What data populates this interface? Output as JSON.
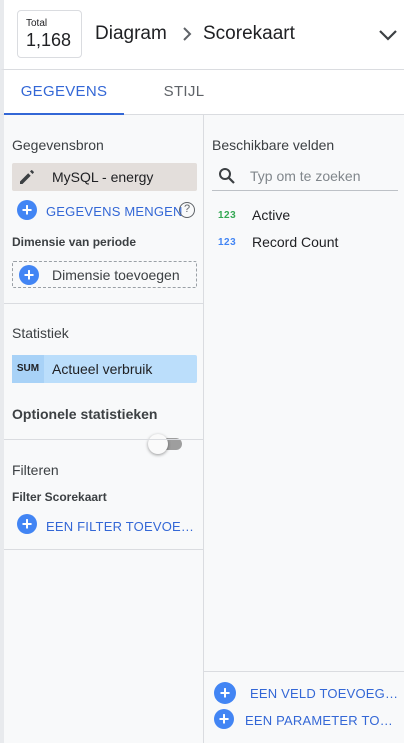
{
  "header": {
    "total_label": "Total",
    "total_value": "1,168",
    "breadcrumb_1": "Diagram",
    "breadcrumb_2": "Scorekaart"
  },
  "tabs": [
    {
      "label": "GEGEVENS",
      "active": true
    },
    {
      "label": "STIJL",
      "active": false
    }
  ],
  "data_source": {
    "title": "Gegevensbron",
    "name": "MySQL - energy",
    "blend_label": "GEGEVENS MENGEN",
    "help_glyph": "?"
  },
  "date_dimension": {
    "title": "Dimensie van periode",
    "add_label": "Dimensie toevoegen"
  },
  "metric": {
    "title": "Statistiek",
    "aggregation": "SUM",
    "name": "Actueel verbruik"
  },
  "optional_metrics": {
    "title": "Optionele statistieken",
    "enabled": false
  },
  "filter": {
    "title": "Filteren",
    "subtitle": "Filter Scorekaart",
    "add_label": "EEN FILTER TOEVOEGEN"
  },
  "available_fields": {
    "title": "Beschikbare velden",
    "search_placeholder": "Typ om te zoeken",
    "items": [
      {
        "type": "123",
        "label": "Active",
        "type_color": "#34a853"
      },
      {
        "type": "123",
        "label": "Record Count",
        "type_color": "#4285f4"
      }
    ],
    "add_field_label": "EEN VELD TOEVOEGEN",
    "add_parameter_label": "EEN PARAMETER TOEVOEGEN"
  },
  "colors": {
    "accent": "#3367d6",
    "plus_button": "#4285f4",
    "metric_chip": "#bbdefb",
    "datasource_chip": "#e3dedb"
  }
}
